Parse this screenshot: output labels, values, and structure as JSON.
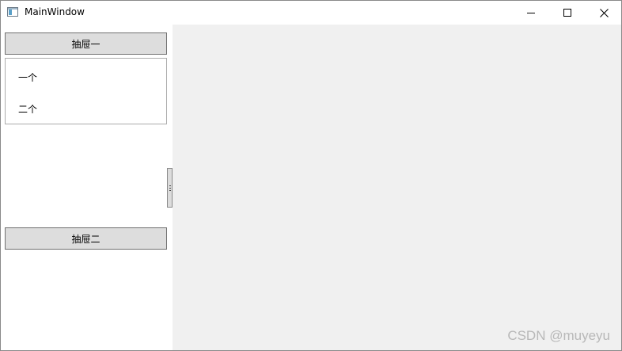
{
  "window": {
    "title": "MainWindow"
  },
  "icons": {
    "app": "app-window-icon",
    "minimize": "minimize-icon",
    "maximize": "maximize-icon",
    "close": "close-icon"
  },
  "sidebar": {
    "drawers": [
      {
        "label": "抽屉一",
        "items": [
          "一个",
          "二个"
        ]
      },
      {
        "label": "抽屉二"
      }
    ]
  },
  "watermark": "CSDN @muyeyu",
  "colors": {
    "main_background": "#f0f0f0",
    "button_face": "#dddddd",
    "button_border": "#707070"
  }
}
